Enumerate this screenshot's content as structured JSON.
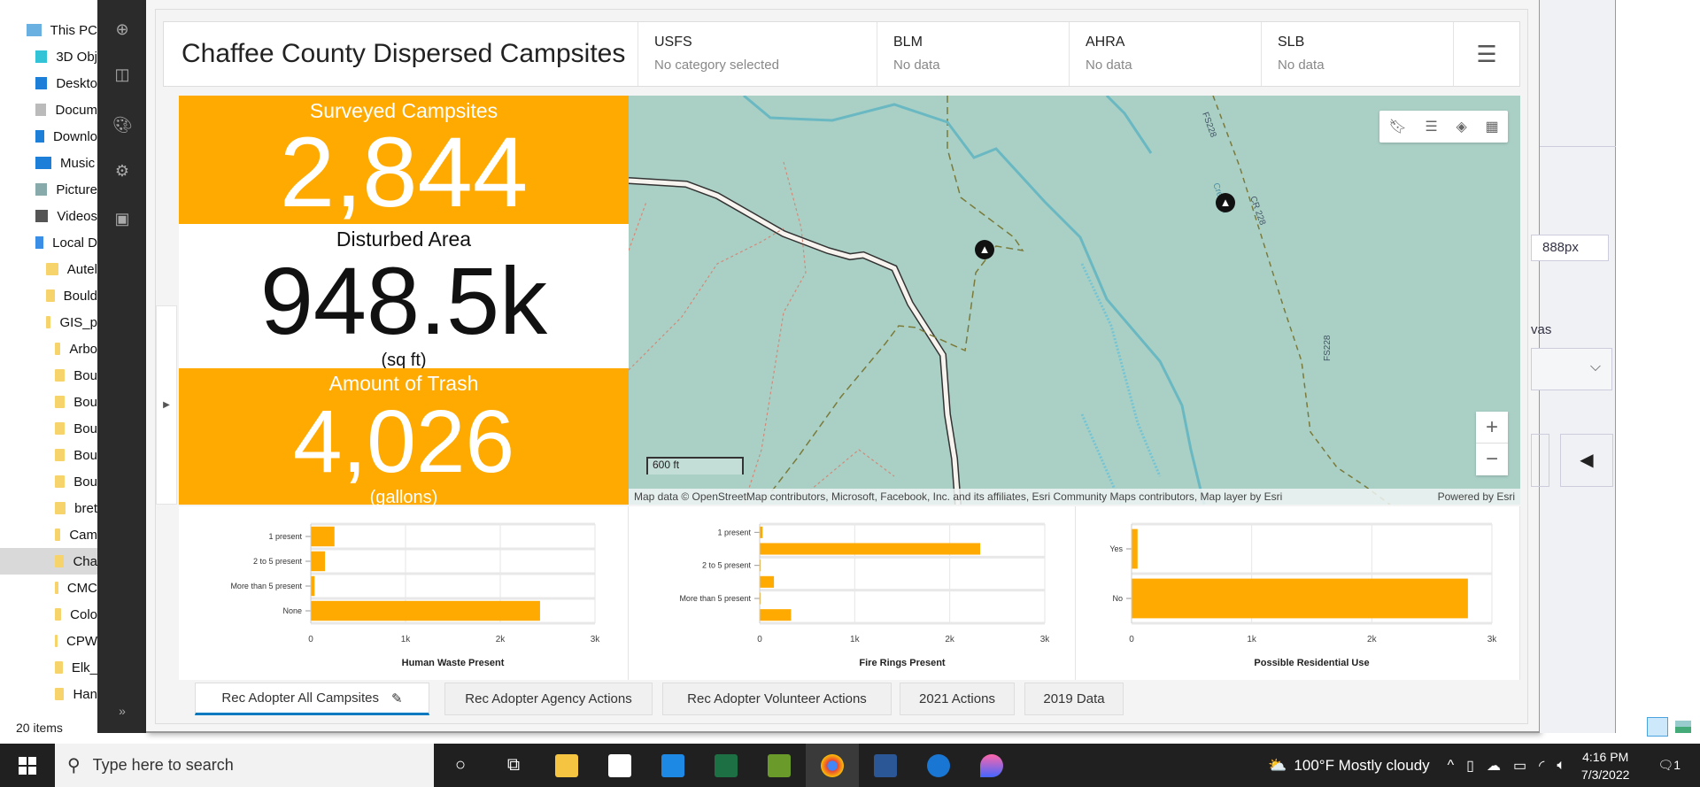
{
  "explorer": {
    "items": [
      "This PC",
      "3D Obj",
      "Deskto",
      "Docum",
      "Downlo",
      "Music",
      "Picture",
      "Videos",
      "Local D",
      "Autel",
      "Bould",
      "GIS_p",
      "Arbo",
      "Bou",
      "Bou",
      "Bou",
      "Bou",
      "Bou",
      "bret",
      "Cam",
      "Cha",
      "CMC",
      "Colo",
      "CPW",
      "Elk_",
      "Han"
    ],
    "status": "20 items"
  },
  "header": {
    "title": "Chaffee County Dispersed Campsites",
    "categories": [
      {
        "name": "USFS",
        "value": "No category selected"
      },
      {
        "name": "BLM",
        "value": "No data"
      },
      {
        "name": "AHRA",
        "value": "No data"
      },
      {
        "name": "SLB",
        "value": "No data"
      }
    ]
  },
  "kpis": [
    {
      "label": "Surveyed Campsites",
      "value": "2,844",
      "unit": ""
    },
    {
      "label": "Disturbed Area",
      "value": "948.5k",
      "unit": "(sq ft)"
    },
    {
      "label": "Amount of Trash",
      "value": "4,026",
      "unit": "(gallons)"
    }
  ],
  "map": {
    "scale": "600 ft",
    "attribution": "Map data © OpenStreetMap contributors, Microsoft, Facebook, Inc. and its affiliates, Esri Community Maps contributors, Map layer by Esri",
    "powered": "Powered by Esri",
    "labels": [
      "FS228",
      "CR 228",
      "FS228",
      "Cre  eek"
    ]
  },
  "chart_data": [
    {
      "type": "bar",
      "orientation": "horizontal",
      "title": "Human Waste Present",
      "categories": [
        "1 present",
        "2 to 5 present",
        "More than 5 present",
        "None"
      ],
      "values": [
        250,
        150,
        40,
        2420
      ],
      "xlim": [
        0,
        3000
      ],
      "ticks": [
        "0",
        "1k",
        "2k",
        "3k"
      ]
    },
    {
      "type": "bar",
      "orientation": "horizontal",
      "title": "Fire Rings Present",
      "categories": [
        "1 present",
        "",
        "2 to 5 present",
        "",
        "More than 5 present",
        ""
      ],
      "values": [
        30,
        2320,
        10,
        150,
        10,
        330
      ],
      "xlim": [
        0,
        3000
      ],
      "ticks": [
        "0",
        "1k",
        "2k",
        "3k"
      ]
    },
    {
      "type": "bar",
      "orientation": "horizontal",
      "title": "Possible Residential Use",
      "categories": [
        "Yes",
        "No"
      ],
      "values": [
        50,
        2800
      ],
      "xlim": [
        0,
        3000
      ],
      "ticks": [
        "0",
        "1k",
        "2k",
        "3k"
      ]
    }
  ],
  "tabs": [
    "Rec Adopter All Campsites",
    "Rec Adopter Agency Actions",
    "Rec Adopter Volunteer Actions",
    "2021 Actions",
    "2019 Data"
  ],
  "rpanel": {
    "size": "888px",
    "label": "vas"
  },
  "taskbar": {
    "search": "Type here to search",
    "weather": "100°F  Mostly cloudy",
    "time": "4:16 PM",
    "date": "7/3/2022",
    "notifications": "1"
  },
  "colors": {
    "accent": "#ffaa00",
    "map": "#aad0c6",
    "tab": "#0079c1"
  }
}
